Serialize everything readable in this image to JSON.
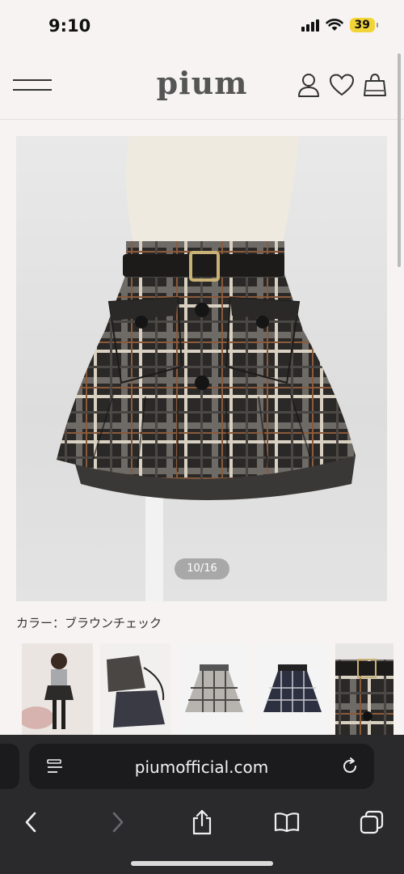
{
  "status_bar": {
    "time": "9:10",
    "battery": "39"
  },
  "header": {
    "logo": "pium",
    "menu_icon": "hamburger-menu-icon",
    "account_icon": "person-icon",
    "favorite_icon": "heart-icon",
    "cart_icon": "shopping-bag-icon"
  },
  "product": {
    "image_counter": "10/16",
    "color_label": "カラー：ブラウンチェック",
    "thumbnails": [
      {
        "name": "model-photo"
      },
      {
        "name": "flat-lay-two-skirts"
      },
      {
        "name": "gray-check-skirt"
      },
      {
        "name": "navy-check-skirt"
      },
      {
        "name": "brown-check-skirt-closeup"
      }
    ]
  },
  "browser": {
    "url": "piumofficial.com",
    "page_menu_icon": "page-menu-icon",
    "reload_icon": "reload-icon",
    "toolbar": [
      "back-icon",
      "forward-icon",
      "share-icon",
      "bookmarks-icon",
      "tabs-icon"
    ]
  }
}
